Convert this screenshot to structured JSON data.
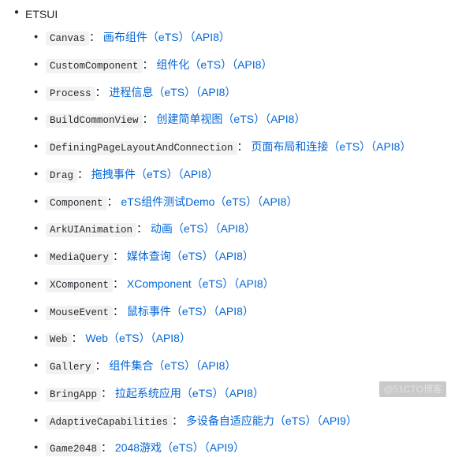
{
  "section": {
    "title": "ETSUI",
    "items": [
      {
        "tag": "Canvas",
        "desc": "画布组件（eTS）（API8）"
      },
      {
        "tag": "CustomComponent",
        "desc": "组件化（eTS）（API8）"
      },
      {
        "tag": "Process",
        "desc": "进程信息（eTS）（API8）"
      },
      {
        "tag": "BuildCommonView",
        "desc": "创建简单视图（eTS）（API8）"
      },
      {
        "tag": "DefiningPageLayoutAndConnection",
        "desc": "页面布局和连接（eTS）（API8）"
      },
      {
        "tag": "Drag",
        "desc": "拖拽事件（eTS）（API8）"
      },
      {
        "tag": "Component",
        "desc": "eTS组件测试Demo（eTS）（API8）"
      },
      {
        "tag": "ArkUIAnimation",
        "desc": "动画（eTS）（API8）"
      },
      {
        "tag": "MediaQuery",
        "desc": "媒体查询（eTS）（API8）"
      },
      {
        "tag": "XComponent",
        "desc": "XComponent（eTS）（API8）"
      },
      {
        "tag": "MouseEvent",
        "desc": "鼠标事件（eTS）（API8）"
      },
      {
        "tag": "Web",
        "desc": "Web（eTS）（API8）"
      },
      {
        "tag": "Gallery",
        "desc": "组件集合（eTS）（API8）"
      },
      {
        "tag": "BringApp",
        "desc": "拉起系统应用（eTS）（API8）"
      },
      {
        "tag": "AdaptiveCapabilities",
        "desc": "多设备自适应能力（eTS）（API9）"
      },
      {
        "tag": "Game2048",
        "desc": "2048游戏（eTS）（API9）"
      }
    ]
  },
  "watermark": "@51CTO博客",
  "glyphs": {
    "bullet": "●",
    "separator": "："
  }
}
